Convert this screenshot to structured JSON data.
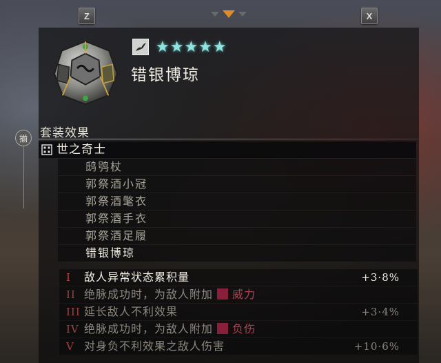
{
  "keys": {
    "left": "Z",
    "right": "X"
  },
  "tabs": {
    "count": 3,
    "active_index": 1,
    "active_color": "#e08a2a"
  },
  "item": {
    "name": "错银博琼",
    "stars": "★★★★★",
    "star_count": 5,
    "rarity_icon": "bird-rarity-icon"
  },
  "set": {
    "emblem": "揃",
    "heading": "套装效果",
    "name": "世之奇士",
    "pieces": [
      {
        "name": "鸱鸮杖",
        "equipped": false
      },
      {
        "name": "郭祭酒小冠",
        "equipped": false
      },
      {
        "name": "郭祭酒氅衣",
        "equipped": false
      },
      {
        "name": "郭祭酒手衣",
        "equipped": false
      },
      {
        "name": "郭祭酒足履",
        "equipped": false
      },
      {
        "name": "错银博琼",
        "equipped": true
      }
    ]
  },
  "bonuses": [
    {
      "num": "I",
      "text": "敌人异常状态累积量",
      "value": "+3·8%",
      "active": true
    },
    {
      "num": "II",
      "text": "绝脉成功时，为敌人附加",
      "tag": "威力",
      "value": "",
      "active": false
    },
    {
      "num": "III",
      "text": "延长敌人不利效果",
      "value": "+3·4%",
      "active": false
    },
    {
      "num": "IV",
      "text": "绝脉成功时，为敌人附加",
      "tag": "负伤",
      "value": "",
      "active": false
    },
    {
      "num": "V",
      "text": "对身负不利效果之敌人伤害",
      "value": "+10·6%",
      "active": false
    }
  ],
  "colors": {
    "star": "#8fe3e0",
    "tag": "#8a1f3c",
    "roman_numeral": "#c04040"
  }
}
